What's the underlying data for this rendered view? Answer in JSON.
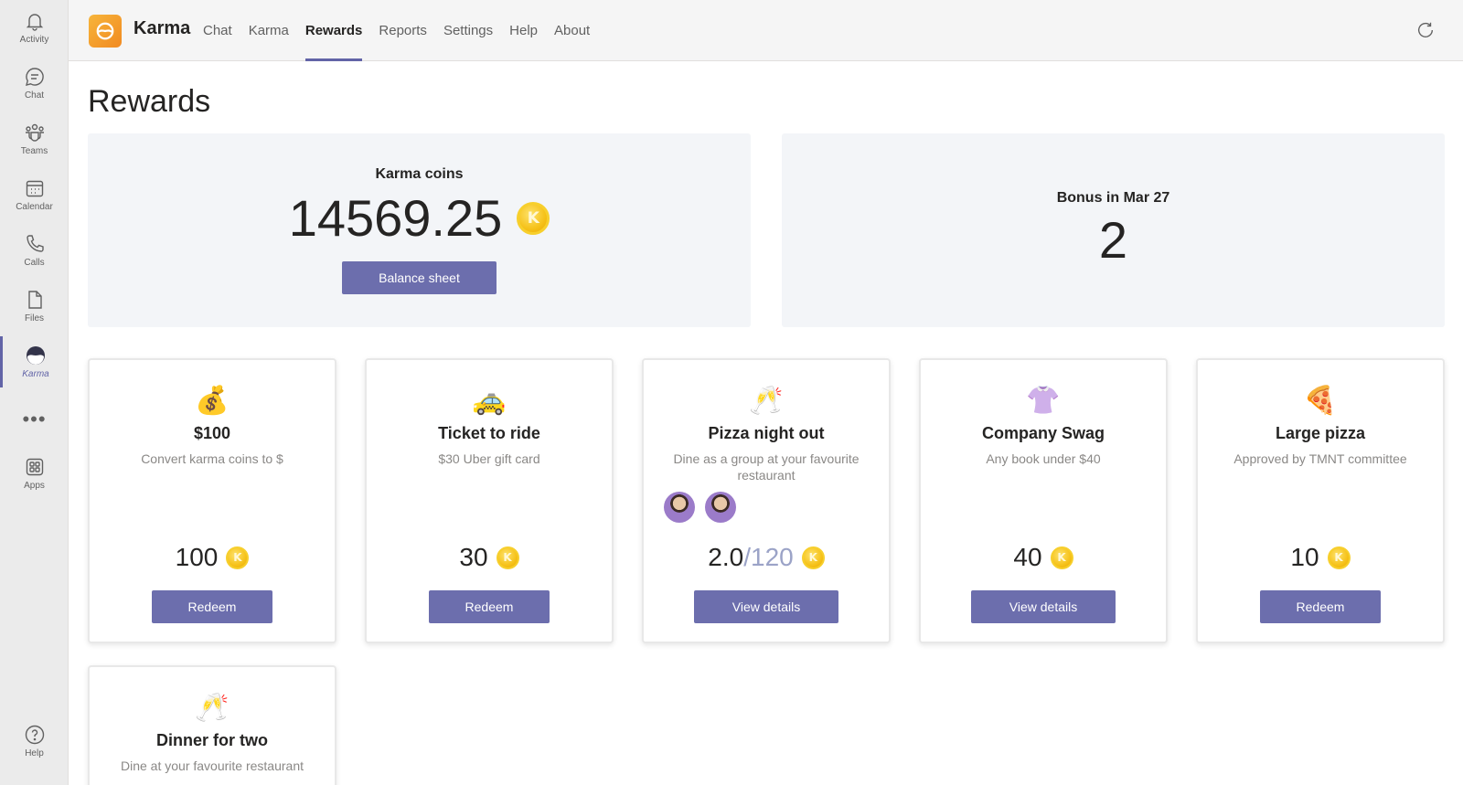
{
  "rail": {
    "items": [
      {
        "label": "Activity",
        "icon": "bell-icon"
      },
      {
        "label": "Chat",
        "icon": "chat-icon"
      },
      {
        "label": "Teams",
        "icon": "teams-icon"
      },
      {
        "label": "Calendar",
        "icon": "calendar-icon"
      },
      {
        "label": "Calls",
        "icon": "phone-icon"
      },
      {
        "label": "Files",
        "icon": "file-icon"
      },
      {
        "label": "Karma",
        "icon": "karma-icon",
        "active": true
      },
      {
        "label": "Apps",
        "icon": "apps-icon"
      },
      {
        "label": "Help",
        "icon": "help-icon"
      }
    ],
    "more": "•••"
  },
  "header": {
    "app_name": "Karma",
    "tabs": [
      "Chat",
      "Karma",
      "Rewards",
      "Reports",
      "Settings",
      "Help",
      "About"
    ],
    "active_tab": "Rewards"
  },
  "main": {
    "title": "Rewards",
    "coins_panel": {
      "title": "Karma coins",
      "value": "14569.25",
      "button": "Balance sheet"
    },
    "bonus_panel": {
      "title": "Bonus in Mar 27",
      "value": "2"
    },
    "coin_glyph": "K",
    "rewards": [
      {
        "emoji": "💰",
        "title": "$100",
        "subtitle": "Convert karma coins to $",
        "price": "100",
        "button": "Redeem"
      },
      {
        "emoji": "🚕",
        "title": "Ticket to ride",
        "subtitle": "$30 Uber gift card",
        "price": "30",
        "button": "Redeem"
      },
      {
        "emoji": "🥂",
        "title": "Pizza night out",
        "subtitle": "Dine as a group at your favourite restaurant",
        "price": "2.0",
        "price_of": "/120",
        "button": "View details",
        "avatars": 2
      },
      {
        "emoji": "👚",
        "title": "Company Swag",
        "subtitle": "Any book under $40",
        "price": "40",
        "button": "View details"
      },
      {
        "emoji": "🍕",
        "title": "Large pizza",
        "subtitle": "Approved by TMNT committee",
        "price": "10",
        "button": "Redeem"
      },
      {
        "emoji": "🥂",
        "title": "Dinner for two",
        "subtitle": "Dine at your favourite restaurant"
      }
    ]
  },
  "colors": {
    "accent": "#6264a7",
    "button": "#6c6ead",
    "coin": "#f6c21a",
    "panel_bg": "#f3f5f8"
  }
}
